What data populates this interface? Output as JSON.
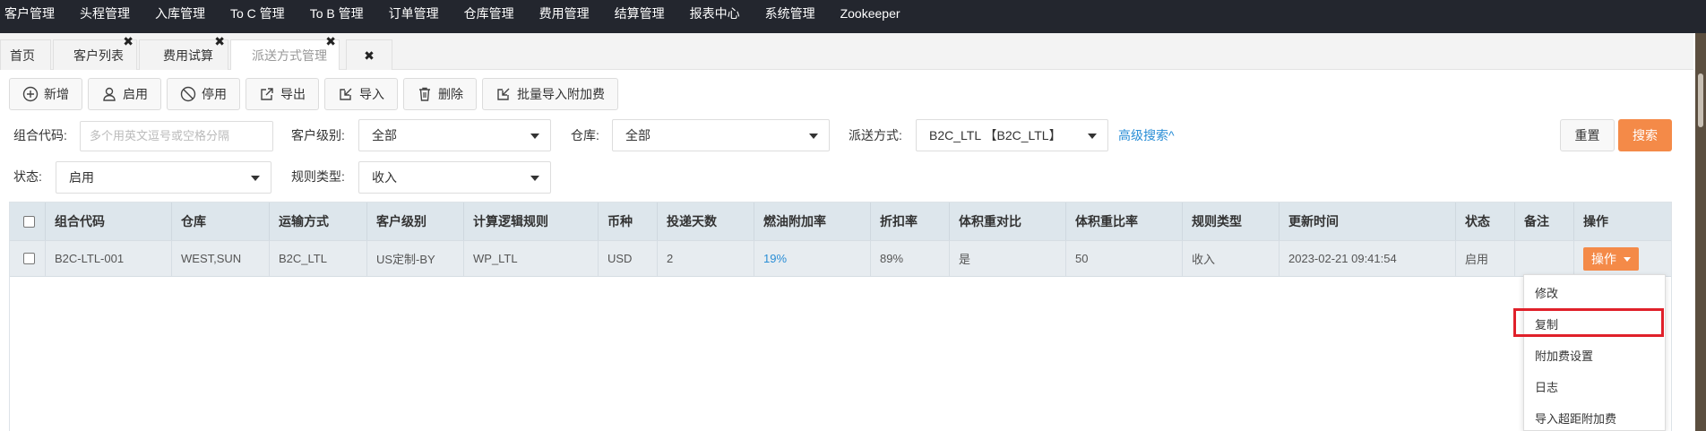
{
  "topnav": {
    "items": [
      "客户管理",
      "头程管理",
      "入库管理",
      "To C 管理",
      "To B 管理",
      "订单管理",
      "仓库管理",
      "费用管理",
      "结算管理",
      "报表中心",
      "系统管理",
      "Zookeeper"
    ]
  },
  "tabs": {
    "items": [
      {
        "label": "首页"
      },
      {
        "label": "客户列表"
      },
      {
        "label": "费用试算"
      },
      {
        "label": "派送方式管理"
      }
    ],
    "close_glyph": "✖"
  },
  "toolbar": {
    "add": "新增",
    "enable": "启用",
    "disable": "停用",
    "export": "导出",
    "import": "导入",
    "delete": "删除",
    "batch_import": "批量导入附加费"
  },
  "filters": {
    "combo_code_label": "组合代码:",
    "combo_code_placeholder": "多个用英文逗号或空格分隔",
    "customer_level_label": "客户级别:",
    "customer_level_value": "全部",
    "warehouse_label": "仓库:",
    "warehouse_value": "全部",
    "delivery_label": "派送方式:",
    "delivery_value": "B2C_LTL 【B2C_LTL】",
    "advanced_search": "高级搜索^",
    "status_label": "状态:",
    "status_value": "启用",
    "rule_type_label": "规则类型:",
    "rule_type_value": "收入",
    "reset": "重置",
    "search": "搜索"
  },
  "table": {
    "headers": [
      "组合代码",
      "仓库",
      "运输方式",
      "客户级别",
      "计算逻辑规则",
      "币种",
      "投递天数",
      "燃油附加率",
      "折扣率",
      "体积重对比",
      "体积重比率",
      "规则类型",
      "更新时间",
      "状态",
      "备注",
      "操作"
    ],
    "row": {
      "code": "B2C-LTL-001",
      "warehouse": "WEST,SUN",
      "transport": "B2C_LTL",
      "level": "US定制-BY",
      "rule": "WP_LTL",
      "currency": "USD",
      "days": "2",
      "fuel": "19%",
      "discount": "89%",
      "vol_compare": "是",
      "vol_ratio": "50",
      "rule_type": "收入",
      "updated": "2023-02-21 09:41:54",
      "status": "启用",
      "remark": "",
      "op": "操作"
    }
  },
  "dropdown": {
    "items": [
      "修改",
      "复制",
      "附加费设置",
      "日志",
      "导入超距附加费"
    ]
  }
}
